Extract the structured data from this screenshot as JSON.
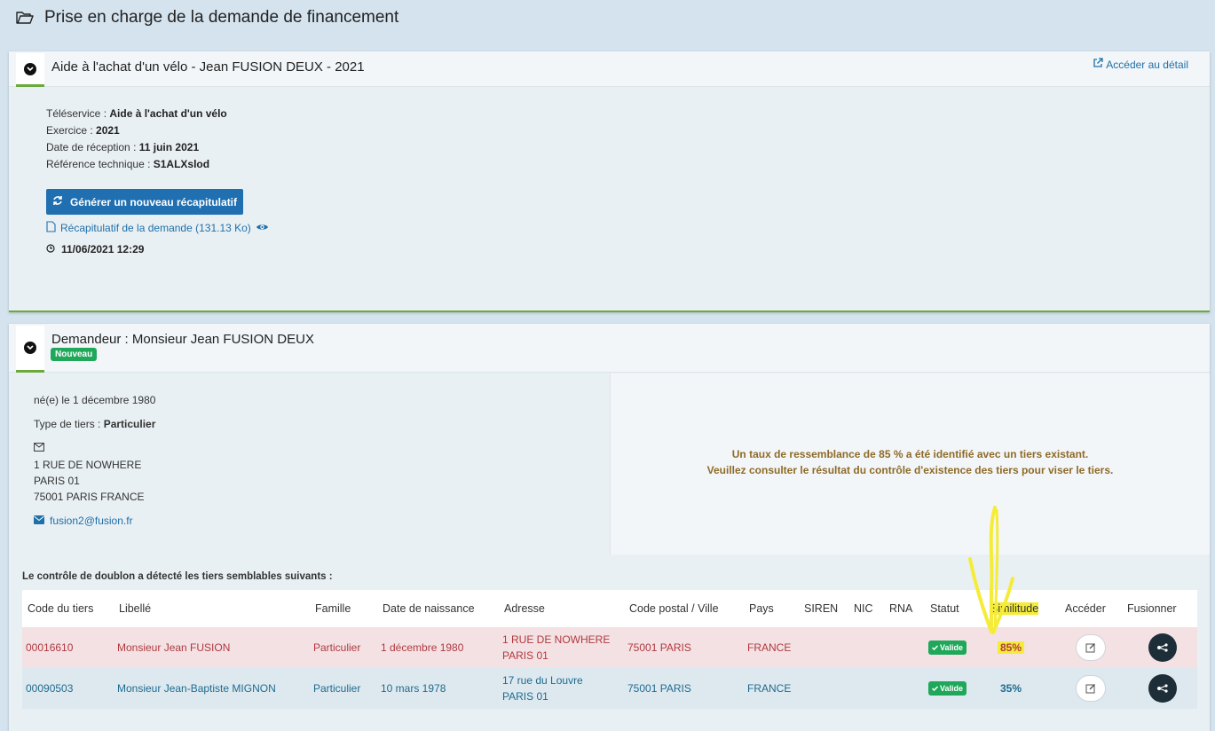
{
  "page": {
    "title": "Prise en charge de la demande de financement"
  },
  "request": {
    "title": "Aide à l'achat d'un vélo - Jean FUSION DEUX - 2021",
    "detail_link": "Accéder au détail",
    "teleservice_label": "Téléservice : ",
    "teleservice": "Aide à l'achat d'un vélo",
    "exercice_label": "Exercice : ",
    "exercice": "2021",
    "reception_label": "Date de réception : ",
    "reception": "11 juin 2021",
    "ref_label": "Référence technique : ",
    "ref": "S1ALXslod",
    "generate_button": "Générer un nouveau récapitulatif",
    "recap_link": "Récapitulatif de la demande (131.13 Ko)",
    "datetime": "11/06/2021 12:29"
  },
  "applicant": {
    "title": "Demandeur : Monsieur Jean FUSION DEUX",
    "badge": "Nouveau",
    "birth": "né(e) le 1 décembre 1980",
    "type_label": "Type de tiers : ",
    "type": "Particulier",
    "address_line1": "1 RUE DE NOWHERE",
    "address_line2": "PARIS 01",
    "address_line3": "75001 PARIS FRANCE",
    "email": "fusion2@fusion.fr",
    "message_line1": "Un taux de ressemblance de 85 % a été identifié avec un tiers existant.",
    "message_line2": "Veuillez consulter le résultat du contrôle d'existence des tiers pour viser le tiers."
  },
  "duplicates": {
    "label": "Le contrôle de doublon a détecté les tiers semblables suivants :",
    "headers": [
      "Code du tiers",
      "Libellé",
      "Famille",
      "Date de naissance",
      "Adresse",
      "Code postal / Ville",
      "Pays",
      "SIREN",
      "NIC",
      "RNA",
      "Statut",
      "Similitude",
      "Accéder",
      "Fusionner"
    ],
    "rows": [
      {
        "code": "00016610",
        "libelle": "Monsieur Jean FUSION",
        "famille": "Particulier",
        "naissance": "1 décembre 1980",
        "adresse1": "1 RUE DE NOWHERE",
        "adresse2": "PARIS 01",
        "cp_ville": "75001 PARIS",
        "pays": "FRANCE",
        "siren": "",
        "nic": "",
        "rna": "",
        "statut": "Valide",
        "similitude": "85%"
      },
      {
        "code": "00090503",
        "libelle": "Monsieur Jean-Baptiste MIGNON",
        "famille": "Particulier",
        "naissance": "10 mars 1978",
        "adresse1": "17 rue du Louvre",
        "adresse2": "PARIS 01",
        "cp_ville": "75001 PARIS",
        "pays": "FRANCE",
        "siren": "",
        "nic": "",
        "rna": "",
        "statut": "Valide",
        "similitude": "35%"
      }
    ]
  },
  "colors": {
    "primary": "#1f6fb1",
    "success": "#1fa85a",
    "warning_text": "#8e6a27",
    "highlight": "#f5ec39",
    "danger_text": "#b03a3f"
  }
}
